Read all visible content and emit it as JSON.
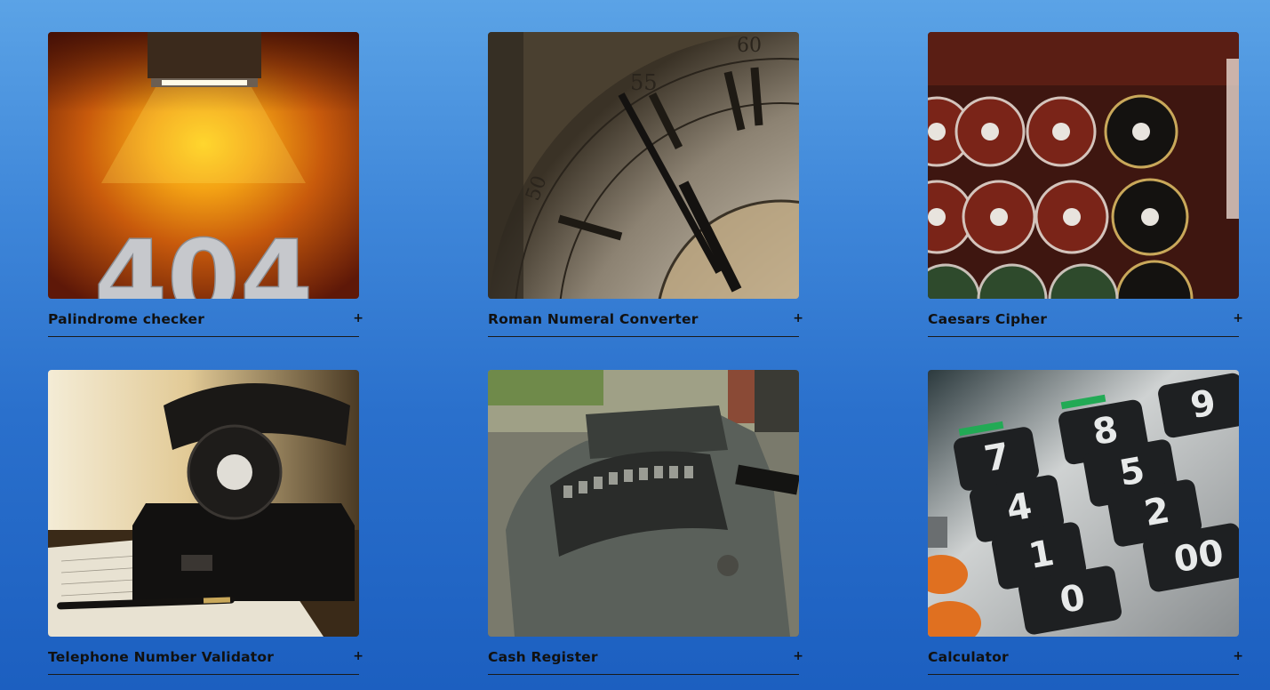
{
  "projects": [
    {
      "title": "Palindrome checker",
      "toggle": "+",
      "image_text": "404"
    },
    {
      "title": "Roman Numeral Converter",
      "toggle": "+"
    },
    {
      "title": "Caesars Cipher",
      "toggle": "+"
    },
    {
      "title": "Telephone Number Validator",
      "toggle": "+"
    },
    {
      "title": "Cash Register",
      "toggle": "+"
    },
    {
      "title": "Calculator",
      "toggle": "+",
      "keys": [
        "7",
        "8",
        "9",
        "4",
        "5",
        "1",
        "2",
        "0",
        "00"
      ]
    }
  ],
  "colors": {
    "background_top": "#5ba3e6",
    "background_bottom": "#1c5fc0",
    "text": "#111111"
  }
}
